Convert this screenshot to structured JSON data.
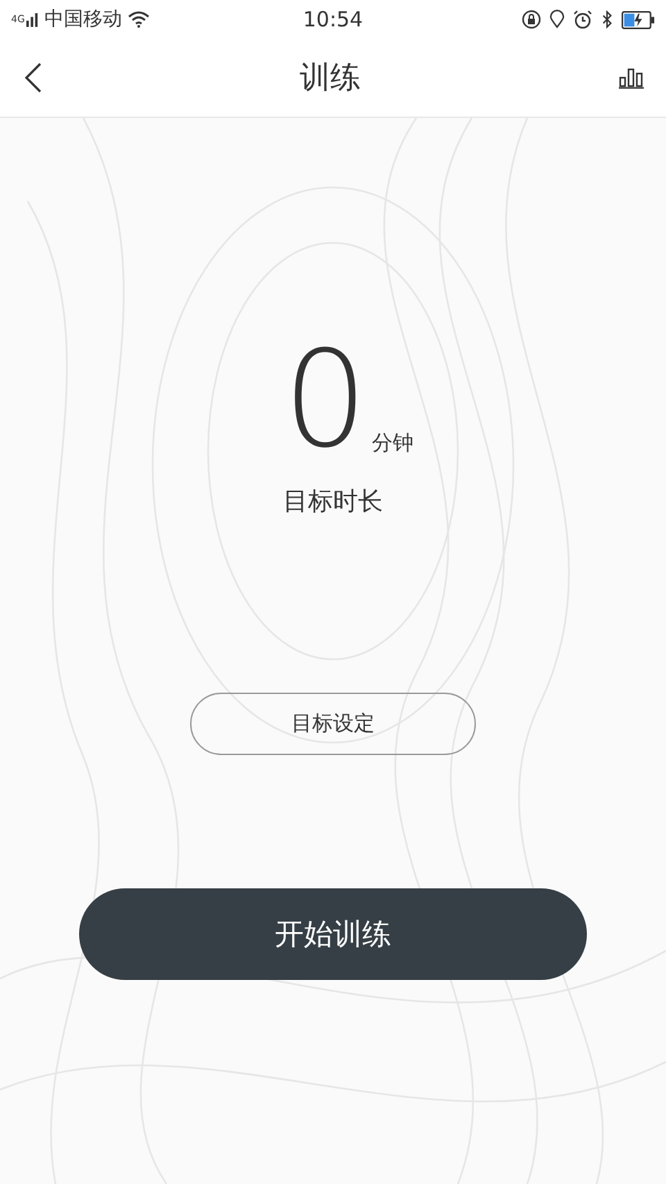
{
  "status_bar": {
    "network": "4G",
    "carrier": "中国移动",
    "time": "10:54"
  },
  "header": {
    "title": "训练"
  },
  "goal": {
    "value": "0",
    "unit": "分钟",
    "label": "目标时长"
  },
  "set_goal_button": "目标设定",
  "start_button": "开始训练"
}
